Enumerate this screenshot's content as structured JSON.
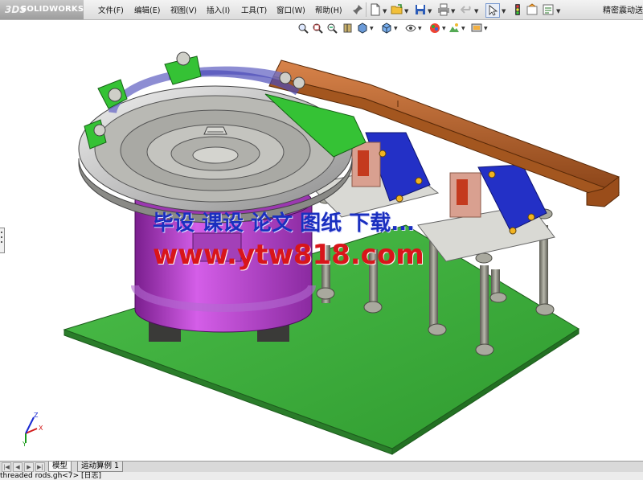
{
  "app": {
    "brand_prefix": "3DS",
    "brand_name": "SOLIDWORKS",
    "document_title": "精密震动送"
  },
  "menu": [
    {
      "label": "文件(F)"
    },
    {
      "label": "编辑(E)"
    },
    {
      "label": "视图(V)"
    },
    {
      "label": "插入(I)"
    },
    {
      "label": "工具(T)"
    },
    {
      "label": "窗口(W)"
    },
    {
      "label": "帮助(H)"
    }
  ],
  "toolbar": {
    "icons": [
      "pin-icon",
      "new-document-icon",
      "open-folder-icon",
      "save-icon",
      "print-icon",
      "undo-icon",
      "select-arrow-icon",
      "traffic-light-icon",
      "file-properties-icon",
      "options-icon"
    ]
  },
  "heads_up_toolbar": {
    "icons": [
      "zoom-to-fit-icon",
      "zoom-to-area-icon",
      "previous-view-icon",
      "section-view-icon",
      "view-orientation-icon",
      "display-style-icon",
      "hide-show-items-icon",
      "edit-appearance-icon",
      "apply-scene-icon",
      "view-settings-icon"
    ]
  },
  "watermark": {
    "line1": "毕设 课设 论文 图纸 下载...",
    "line2": "www.ytw818.com",
    "colors": {
      "line1": "#1a2fbf",
      "line2": "#d8151a"
    }
  },
  "triad": {
    "x": "X",
    "y": "Y",
    "z": "Z"
  },
  "tabs": [
    {
      "label": "模型",
      "active": true
    },
    {
      "label": "运动算例 1",
      "active": false
    }
  ],
  "status": {
    "text": "threaded rods.gh<7> [日志]"
  },
  "colors": {
    "base_plate": "#3ca53c",
    "bowl_base": "#b03cc8",
    "bracket": "#2828c8",
    "track": "#b4642a",
    "bowl": "#c8c8c8"
  }
}
